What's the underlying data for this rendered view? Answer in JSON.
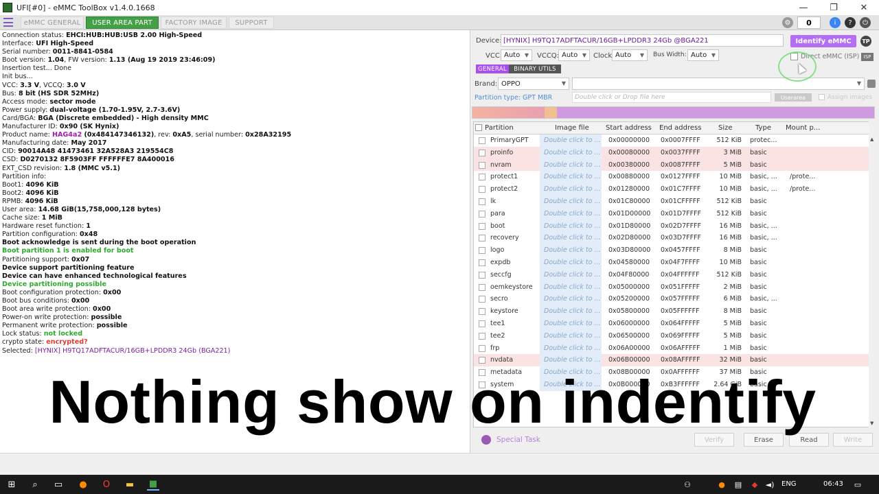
{
  "window": {
    "title": "UFI[#0] - eMMC ToolBox v1.4.0.1668",
    "min": "—",
    "max": "❐",
    "close": "✕"
  },
  "tabs": [
    {
      "label": "eMMC GENERAL",
      "active": false
    },
    {
      "label": "USER AREA PART",
      "active": true
    },
    {
      "label": "FACTORY IMAGE",
      "active": false
    },
    {
      "label": "SUPPORT",
      "active": false
    }
  ],
  "toolbar": {
    "counter": "0"
  },
  "log": [
    [
      {
        "t": "Connection status: "
      },
      {
        "t": "EHCI:HUB:HUB:USB 2.00 High-Speed",
        "s": "b"
      }
    ],
    [
      {
        "t": "Interface: "
      },
      {
        "t": "UFI High-Speed",
        "s": "b"
      }
    ],
    [
      {
        "t": "Serial number: "
      },
      {
        "t": "0011-8841-0584",
        "s": "b"
      }
    ],
    [
      {
        "t": " Boot version: "
      },
      {
        "t": "1.04",
        "s": "b"
      },
      {
        "t": ", FW version: "
      },
      {
        "t": "1.13 (Aug 19 2019 23:46:09)",
        "s": "b"
      }
    ],
    [
      {
        "t": "Insertion test... Done"
      }
    ],
    [
      {
        "t": "Init bus..."
      }
    ],
    [
      {
        "t": "VCC: "
      },
      {
        "t": "3.3 V",
        "s": "b"
      },
      {
        "t": ", VCCQ: "
      },
      {
        "t": "3.0 V",
        "s": "b"
      }
    ],
    [
      {
        "t": "Bus: "
      },
      {
        "t": "8 bit (HS SDR 52MHz)",
        "s": "b"
      }
    ],
    [
      {
        "t": "Access mode: "
      },
      {
        "t": "sector mode",
        "s": "b"
      }
    ],
    [
      {
        "t": "Power supply: "
      },
      {
        "t": "dual-voltage (1.70-1.95V, 2.7-3.6V)",
        "s": "b"
      }
    ],
    [
      {
        "t": " Card/BGA: "
      },
      {
        "t": "BGA (Discrete embedded) - High density MMC",
        "s": "b"
      }
    ],
    [
      {
        "t": " Manufacturer ID: "
      },
      {
        "t": "0x90 (SK Hynix)",
        "s": "b"
      }
    ],
    [
      {
        "t": " Product name: "
      },
      {
        "t": "HAG4a2",
        "s": "purple"
      },
      {
        "t": " (0x484147346132)",
        "s": "b"
      },
      {
        "t": ", rev: "
      },
      {
        "t": "0xA5",
        "s": "b"
      },
      {
        "t": ", serial number: "
      },
      {
        "t": "0x28A32195",
        "s": "b"
      }
    ],
    [
      {
        "t": " Manufacturing date: "
      },
      {
        "t": "May 2017",
        "s": "b"
      }
    ],
    [
      {
        "t": "CID: "
      },
      {
        "t": "90014A48 41473461 32A528A3 219554C8",
        "s": "b"
      }
    ],
    [
      {
        "t": "CSD: "
      },
      {
        "t": "D0270132 8F5903FF FFFFFFE7 8A400016",
        "s": "b"
      }
    ],
    [
      {
        "t": "EXT_CSD revision: "
      },
      {
        "t": "1.8 (MMC v5.1)",
        "s": "b"
      }
    ],
    [
      {
        "t": "Partition info:"
      }
    ],
    [
      {
        "t": " Boot1: "
      },
      {
        "t": "4096 KiB",
        "s": "b"
      }
    ],
    [
      {
        "t": " Boot2: "
      },
      {
        "t": "4096 KiB",
        "s": "b"
      }
    ],
    [
      {
        "t": " RPMB: "
      },
      {
        "t": "4096 KiB",
        "s": "b"
      }
    ],
    [
      {
        "t": " User area: "
      },
      {
        "t": "14.68 GiB(15,758,000,128 bytes)",
        "s": "b"
      }
    ],
    [
      {
        "t": "Cache size: "
      },
      {
        "t": "1 MiB",
        "s": "b"
      }
    ],
    [
      {
        "t": "Hardware reset function: "
      },
      {
        "t": "1",
        "s": "b"
      }
    ],
    [
      {
        "t": "Partition configuration: "
      },
      {
        "t": "0x48",
        "s": "b"
      }
    ],
    [
      {
        "t": " Boot acknowledge is sent during the boot operation",
        "s": "b"
      }
    ],
    [
      {
        "t": " Boot partition 1 is enabled for boot",
        "s": "green"
      }
    ],
    [
      {
        "t": "Partitioning support: "
      },
      {
        "t": "0x07",
        "s": "b"
      }
    ],
    [
      {
        "t": " Device support partitioning feature",
        "s": "b"
      }
    ],
    [
      {
        "t": " Device can have enhanced technological features",
        "s": "b"
      }
    ],
    [
      {
        "t": " Device partitioning possible",
        "s": "green"
      }
    ],
    [
      {
        "t": "Boot configuration protection: "
      },
      {
        "t": "0x00",
        "s": "b"
      }
    ],
    [
      {
        "t": "Boot bus conditions: "
      },
      {
        "t": "0x00",
        "s": "b"
      }
    ],
    [
      {
        "t": "Boot area write protection: "
      },
      {
        "t": "0x00",
        "s": "b"
      }
    ],
    [
      {
        "t": " Power-on write protection: "
      },
      {
        "t": "possible",
        "s": "b"
      }
    ],
    [
      {
        "t": " Permanent write protection: "
      },
      {
        "t": "possible",
        "s": "b"
      }
    ],
    [
      {
        "t": " Lock status: "
      },
      {
        "t": "not locked",
        "s": "green"
      }
    ],
    [
      {
        "t": "crypto state: "
      },
      {
        "t": "encrypted?",
        "s": "red"
      }
    ],
    [
      {
        "t": "Selected: "
      },
      {
        "t": "[HYNIX] H9TQ17ADFTACUR/16GB+LPDDR3 24Gb   (BGA221)",
        "s": "blue"
      }
    ]
  ],
  "device": {
    "label": "Device:",
    "value": "[HYNIX] H9TQ17ADFTACUR/16GB+LPDDR3 24Gb  @BGA221",
    "identify_label": "Identify eMMC",
    "tp": "TP",
    "vcc_label": "VCC:",
    "vcc": "Auto",
    "vccq_label": "VCCQ:",
    "vccq": "Auto",
    "clock_label": "Clock:",
    "clock": "Auto",
    "bus_label": "Bus Width:",
    "bus": "Auto",
    "direct_label": "Direct eMMC (ISP)",
    "isp": "ISP"
  },
  "subtabs": {
    "general": "GENERAL",
    "binary": "BINARY UTILS"
  },
  "brand": {
    "label": "Brand:",
    "value": "OPPO"
  },
  "partition_type": {
    "label": "Partition type: GPT MBR",
    "placeholder": "Double click or Drop file here",
    "userarea": "Userarea",
    "assign": "Assign images"
  },
  "table": {
    "headers": [
      "Partition",
      "Image file",
      "Start address",
      "End address",
      "Size",
      "Type",
      "Mount p..."
    ],
    "image_hint": "Double click to ...",
    "rows": [
      {
        "name": "PrimaryGPT",
        "start": "0x00000000",
        "end": "0x0007FFFF",
        "size": "512 KiB",
        "type": "protec...",
        "mount": "",
        "pink": false
      },
      {
        "name": "proinfo",
        "start": "0x00080000",
        "end": "0x0037FFFF",
        "size": "3 MiB",
        "type": "basic",
        "mount": "",
        "pink": true
      },
      {
        "name": "nvram",
        "start": "0x00380000",
        "end": "0x0087FFFF",
        "size": "5 MiB",
        "type": "basic",
        "mount": "",
        "pink": true
      },
      {
        "name": "protect1",
        "start": "0x00880000",
        "end": "0x0127FFFF",
        "size": "10 MiB",
        "type": "basic, ...",
        "mount": "/prote...",
        "pink": false
      },
      {
        "name": "protect2",
        "start": "0x01280000",
        "end": "0x01C7FFFF",
        "size": "10 MiB",
        "type": "basic, ...",
        "mount": "/prote...",
        "pink": false
      },
      {
        "name": "lk",
        "start": "0x01C80000",
        "end": "0x01CFFFFF",
        "size": "512 KiB",
        "type": "basic",
        "mount": "",
        "pink": false
      },
      {
        "name": "para",
        "start": "0x01D00000",
        "end": "0x01D7FFFF",
        "size": "512 KiB",
        "type": "basic",
        "mount": "",
        "pink": false
      },
      {
        "name": "boot",
        "start": "0x01D80000",
        "end": "0x02D7FFFF",
        "size": "16 MiB",
        "type": "basic, ...",
        "mount": "",
        "pink": false
      },
      {
        "name": "recovery",
        "start": "0x02D80000",
        "end": "0x03D7FFFF",
        "size": "16 MiB",
        "type": "basic, ...",
        "mount": "",
        "pink": false
      },
      {
        "name": "logo",
        "start": "0x03D80000",
        "end": "0x0457FFFF",
        "size": "8 MiB",
        "type": "basic",
        "mount": "",
        "pink": false
      },
      {
        "name": "expdb",
        "start": "0x04580000",
        "end": "0x04F7FFFF",
        "size": "10 MiB",
        "type": "basic",
        "mount": "",
        "pink": false
      },
      {
        "name": "seccfg",
        "start": "0x04F80000",
        "end": "0x04FFFFFF",
        "size": "512 KiB",
        "type": "basic",
        "mount": "",
        "pink": false
      },
      {
        "name": "oemkeystore",
        "start": "0x05000000",
        "end": "0x051FFFFF",
        "size": "2 MiB",
        "type": "basic",
        "mount": "",
        "pink": false
      },
      {
        "name": "secro",
        "start": "0x05200000",
        "end": "0x057FFFFF",
        "size": "6 MiB",
        "type": "basic, ...",
        "mount": "",
        "pink": false
      },
      {
        "name": "keystore",
        "start": "0x05800000",
        "end": "0x05FFFFFF",
        "size": "8 MiB",
        "type": "basic",
        "mount": "",
        "pink": false
      },
      {
        "name": "tee1",
        "start": "0x06000000",
        "end": "0x064FFFFF",
        "size": "5 MiB",
        "type": "basic",
        "mount": "",
        "pink": false
      },
      {
        "name": "tee2",
        "start": "0x06500000",
        "end": "0x069FFFFF",
        "size": "5 MiB",
        "type": "basic",
        "mount": "",
        "pink": false
      },
      {
        "name": "frp",
        "start": "0x06A00000",
        "end": "0x06AFFFFF",
        "size": "1 MiB",
        "type": "basic",
        "mount": "",
        "pink": false
      },
      {
        "name": "nvdata",
        "start": "0x06B00000",
        "end": "0x08AFFFFF",
        "size": "32 MiB",
        "type": "basic",
        "mount": "",
        "pink": true
      },
      {
        "name": "metadata",
        "start": "0x08B00000",
        "end": "0x0AFFFFFF",
        "size": "37 MiB",
        "type": "basic",
        "mount": "",
        "pink": false
      },
      {
        "name": "system",
        "start": "0x0B000000",
        "end": "0xB3FFFFFF",
        "size": "2.64 GiB",
        "type": "basic",
        "mount": "",
        "pink": false
      }
    ]
  },
  "actions": {
    "special": "Special Task",
    "verify": "Verify",
    "erase": "Erase",
    "read": "Read",
    "write": "Write"
  },
  "taskbar": {
    "lang": "ENG",
    "time": "06:43"
  },
  "caption": "Nothing show on indentify"
}
